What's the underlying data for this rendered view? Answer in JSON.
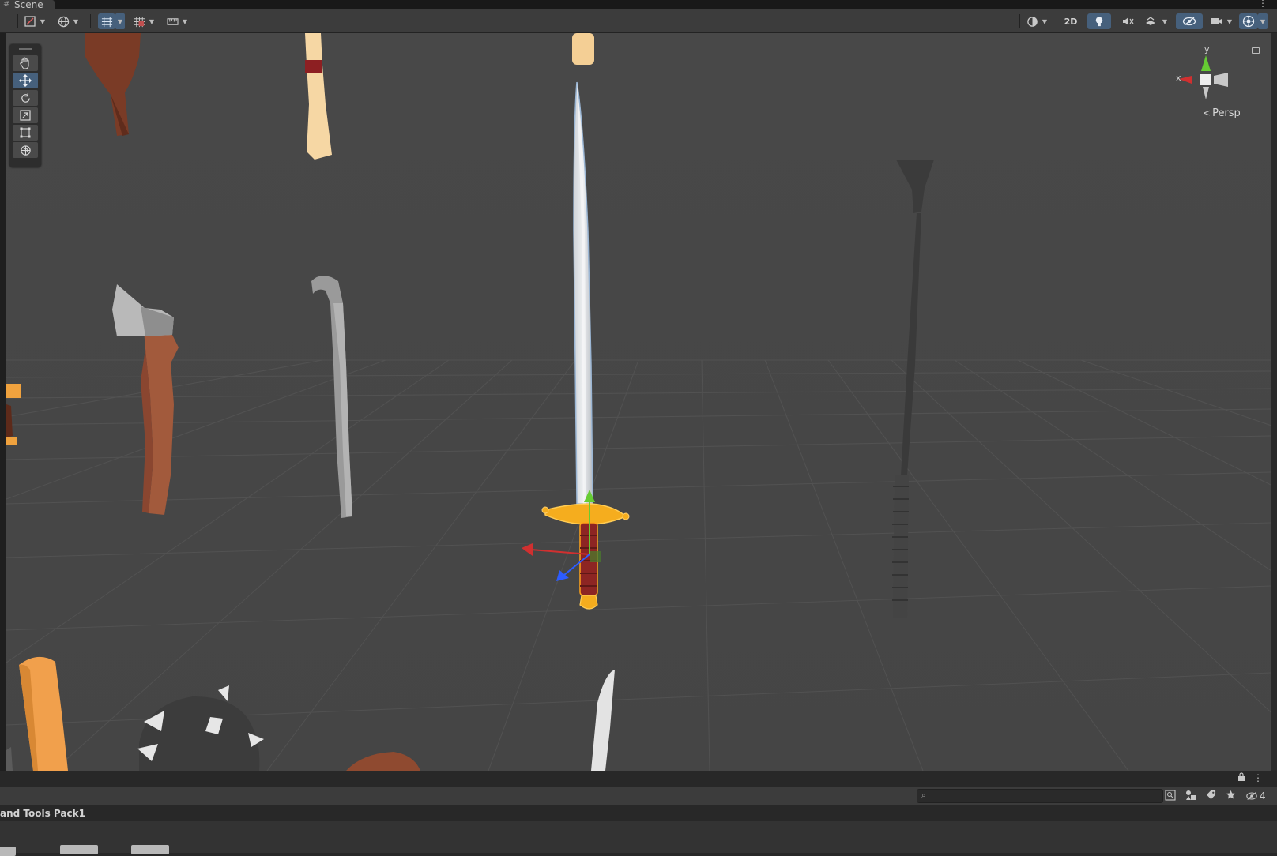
{
  "window": {
    "tab_label": "Scene",
    "tab_icon": "hash-icon",
    "menu_glyph": "⋮"
  },
  "toolbar": {
    "left": [
      {
        "name": "draw-mode-icon",
        "has_dropdown": true
      },
      {
        "name": "globe-icon",
        "has_dropdown": true
      },
      {
        "name": "grid-snap-icon",
        "active": true,
        "has_dropdown": true
      },
      {
        "name": "increment-snap-icon",
        "has_dropdown": true
      },
      {
        "name": "ruler-icon",
        "has_dropdown": true
      }
    ],
    "right": [
      {
        "name": "shading-mode-icon",
        "has_dropdown": true
      },
      {
        "name": "2d-toggle",
        "label": "2D"
      },
      {
        "name": "lighting-icon",
        "active": true
      },
      {
        "name": "audio-icon"
      },
      {
        "name": "effects-icon",
        "has_dropdown": true
      },
      {
        "name": "hidden-objects-icon",
        "active": true
      },
      {
        "name": "camera-icon",
        "has_dropdown": true
      },
      {
        "name": "gizmos-icon",
        "active": true,
        "has_dropdown": true
      }
    ]
  },
  "tools": [
    {
      "name": "hand-tool-icon"
    },
    {
      "name": "move-tool-icon",
      "active": true
    },
    {
      "name": "rotate-tool-icon"
    },
    {
      "name": "scale-tool-icon"
    },
    {
      "name": "rect-tool-icon"
    },
    {
      "name": "transform-tool-icon"
    }
  ],
  "gizmo": {
    "y_label": "y",
    "x_label": "x",
    "projection_label": "Persp",
    "projection_glyph": "<"
  },
  "colors": {
    "selection_outline": "#ffa31a",
    "axis_x": "#d03030",
    "axis_y": "#66cc33",
    "axis_z": "#2d5cff",
    "active_button": "#46607c",
    "floor": "#474747"
  },
  "bottom": {
    "lock_glyph": "🔒",
    "menu_glyph": "⋮"
  },
  "project": {
    "search_placeholder": "",
    "hidden_count": "4",
    "path": "and Tools Pack1"
  }
}
